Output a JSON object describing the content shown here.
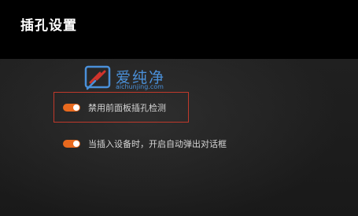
{
  "header": {
    "title": "插孔设置"
  },
  "watermark": {
    "name": "爱纯净",
    "url": "aichunjing.com",
    "logo_icon": "pe-logo-icon"
  },
  "options": [
    {
      "label": "禁用前面板插孔检测",
      "enabled": true,
      "highlighted": true
    },
    {
      "label": "当插入设备时，开启自动弹出对话框",
      "enabled": true,
      "highlighted": false
    }
  ],
  "colors": {
    "toggle_on": "#e8691e",
    "highlight_border": "#c0392b",
    "header_bg": "#000000",
    "watermark_blue": "#4a90d9"
  }
}
